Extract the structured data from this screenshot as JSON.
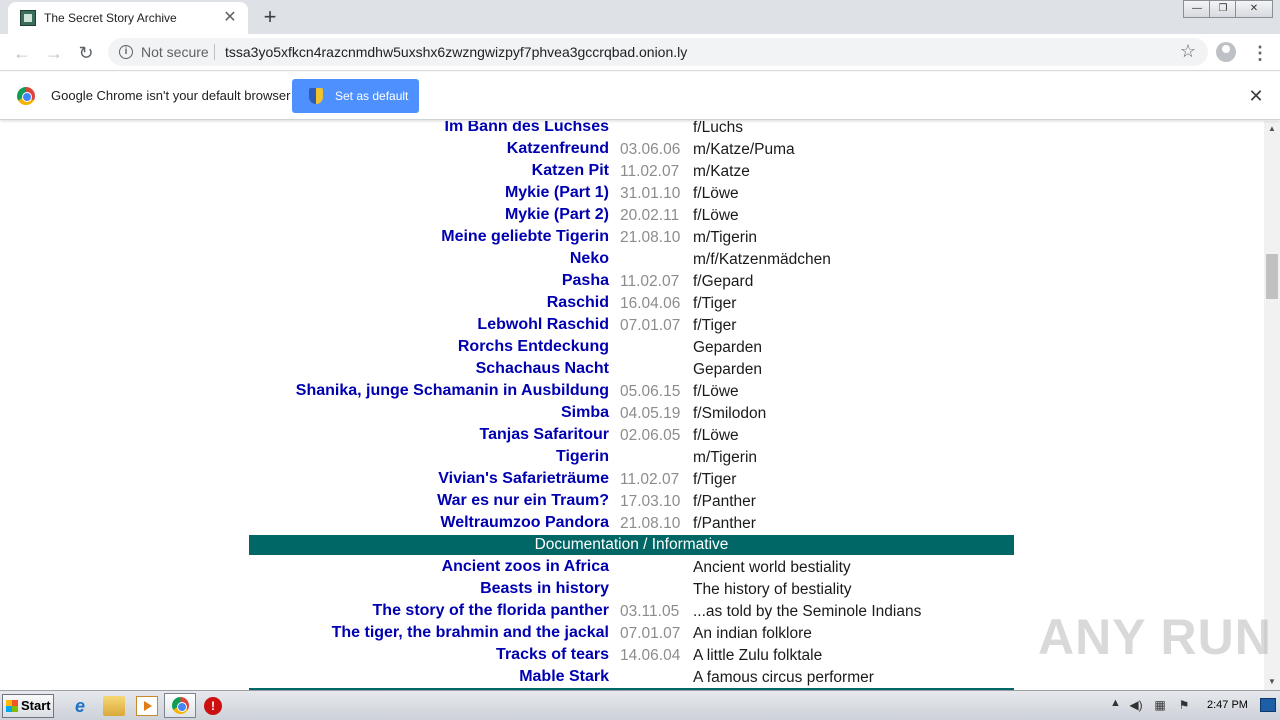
{
  "browser": {
    "tab_title": "The Secret Story Archive",
    "tab_close": "✕",
    "new_tab": "+",
    "security_label": "Not secure",
    "url": "tssa3yo5xfkcn4razcnmdhw5uxshx6zwzngwizpyf7phvea3gccrqbad.onion.ly",
    "window_controls": [
      "—",
      "❐",
      "✕"
    ]
  },
  "infobar": {
    "message": "Google Chrome isn't your default browser",
    "button_label": "Set as default",
    "close": "✕"
  },
  "stories_top": [
    {
      "title": "Im Bann des Luchses",
      "date": "",
      "desc": "f/Luchs"
    },
    {
      "title": "Katzenfreund",
      "date": "03.06.06",
      "desc": "m/Katze/Puma"
    },
    {
      "title": "Katzen Pit",
      "date": "11.02.07",
      "desc": "m/Katze"
    },
    {
      "title": "Mykie (Part 1)",
      "date": "31.01.10",
      "desc": "f/Löwe"
    },
    {
      "title": "Mykie (Part 2)",
      "date": "20.02.11",
      "desc": "f/Löwe"
    },
    {
      "title": "Meine geliebte Tigerin",
      "date": "21.08.10",
      "desc": "m/Tigerin"
    },
    {
      "title": "Neko",
      "date": "",
      "desc": "m/f/Katzenmädchen"
    },
    {
      "title": "Pasha",
      "date": "11.02.07",
      "desc": "f/Gepard"
    },
    {
      "title": "Raschid",
      "date": "16.04.06",
      "desc": "f/Tiger"
    },
    {
      "title": "Lebwohl Raschid",
      "date": "07.01.07",
      "desc": "f/Tiger"
    },
    {
      "title": "Rorchs Entdeckung",
      "date": "",
      "desc": "Geparden"
    },
    {
      "title": "Schachaus Nacht",
      "date": "",
      "desc": "Geparden"
    },
    {
      "title": "Shanika, junge Schamanin in Ausbildung",
      "date": "05.06.15",
      "desc": "f/Löwe"
    },
    {
      "title": "Simba",
      "date": "04.05.19",
      "desc": "f/Smilodon"
    },
    {
      "title": "Tanjas Safaritour",
      "date": "02.06.05",
      "desc": "f/Löwe"
    },
    {
      "title": "Tigerin",
      "date": "",
      "desc": "m/Tigerin"
    },
    {
      "title": "Vivian's Safarieträume",
      "date": "11.02.07",
      "desc": "f/Tiger"
    },
    {
      "title": "War es nur ein Traum?",
      "date": "17.03.10",
      "desc": "f/Panther"
    },
    {
      "title": "Weltraumzoo Pandora",
      "date": "21.08.10",
      "desc": "f/Panther"
    }
  ],
  "section_header": "Documentation / Informative",
  "stories_docs": [
    {
      "title": "Ancient zoos in Africa",
      "date": "",
      "desc": "Ancient world bestiality"
    },
    {
      "title": "Beasts in history",
      "date": "",
      "desc": "The history of bestiality"
    },
    {
      "title": "The story of the florida panther",
      "date": "03.11.05",
      "desc": "...as told by the Seminole Indians"
    },
    {
      "title": "The tiger, the brahmin and the jackal",
      "date": "07.01.07",
      "desc": "An indian folklore"
    },
    {
      "title": "Tracks of tears",
      "date": "14.06.04",
      "desc": "A little Zulu folktale"
    },
    {
      "title": "Mable Stark",
      "date": "",
      "desc": "A famous circus performer"
    }
  ],
  "watermark": "ANY RUN",
  "taskbar": {
    "start_label": "Start",
    "clock": "2:47 PM",
    "stop_glyph": "!"
  },
  "colors": {
    "link": "#0000b0",
    "section_bg": "#006666",
    "date": "#8c8c8c",
    "button_blue": "#4d90fe"
  }
}
